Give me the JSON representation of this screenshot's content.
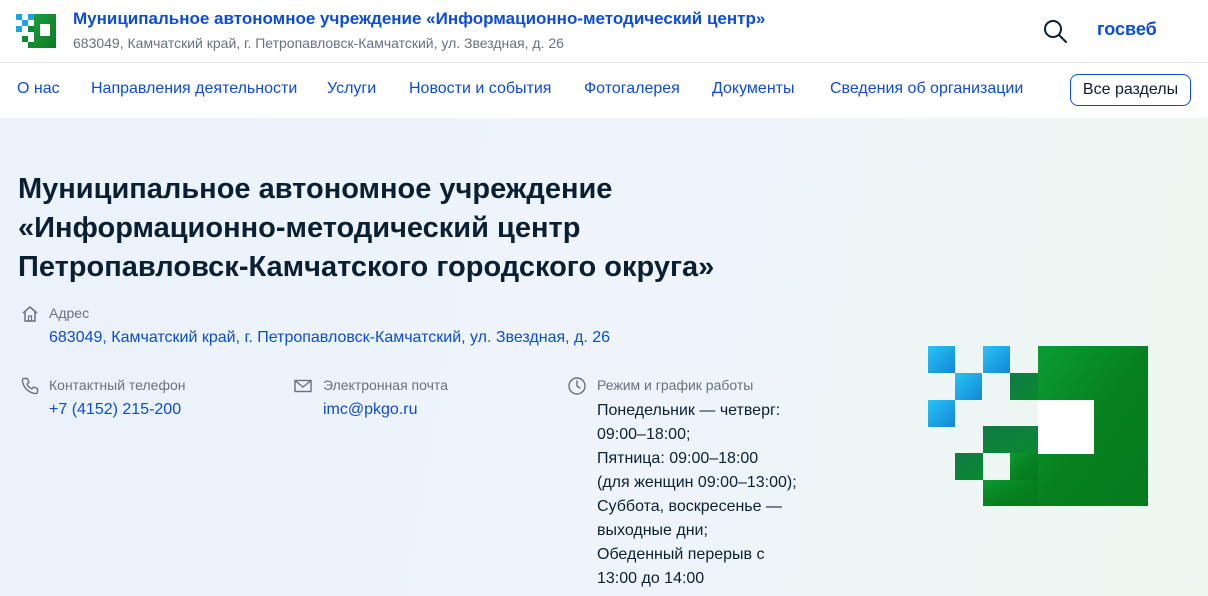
{
  "header": {
    "org_title": "Муниципальное автономное учреждение «Информационно-методический центр»",
    "org_address": "683049, Камчатский край, г. Петропавловск-Камчатский, ул. Звездная, д. 26",
    "brand": "госвеб"
  },
  "nav": {
    "items": [
      {
        "label": "О нас"
      },
      {
        "label": "Направления деятельности"
      },
      {
        "label": "Услуги"
      },
      {
        "label": "Новости и события"
      },
      {
        "label": "Фотогалерея"
      },
      {
        "label": "Документы"
      },
      {
        "label": "Сведения об организации"
      }
    ],
    "all_sections": "Все разделы"
  },
  "hero": {
    "title_lines": [
      "Муниципальное автономное учреждение",
      "«Информационно-методический центр",
      "Петропавловск-Камчатского городского округа»"
    ],
    "address": {
      "label": "Адрес",
      "value": "683049, Камчатский край, г. Петропавловск-Камчатский, ул. Звездная, д. 26"
    },
    "phone": {
      "label": "Контактный телефон",
      "value": "+7 (4152) 215-200"
    },
    "email": {
      "label": "Электронная почта",
      "value": "imc@pkgo.ru"
    },
    "schedule": {
      "label": "Режим и график работы",
      "lines": [
        "Понедельник — четверг:",
        "09:00–18:00;",
        "Пятница: 09:00–18:00",
        "(для женщин 09:00–13:00);",
        "Суббота, воскресенье —",
        "выходные дни;",
        "Обеденный перерыв с",
        "13:00 до 14:00"
      ]
    }
  },
  "icons": {
    "logo": "gosweb-logo-icon",
    "search": "search-icon",
    "address": "home-icon",
    "phone": "phone-icon",
    "email": "envelope-icon",
    "schedule": "clock-icon"
  },
  "colors": {
    "link": "#0d4cd3",
    "text": "#0b1f33",
    "muted": "#66727f",
    "logo_green": "#0a8a2e",
    "logo_blue": "#1aa3e8"
  }
}
